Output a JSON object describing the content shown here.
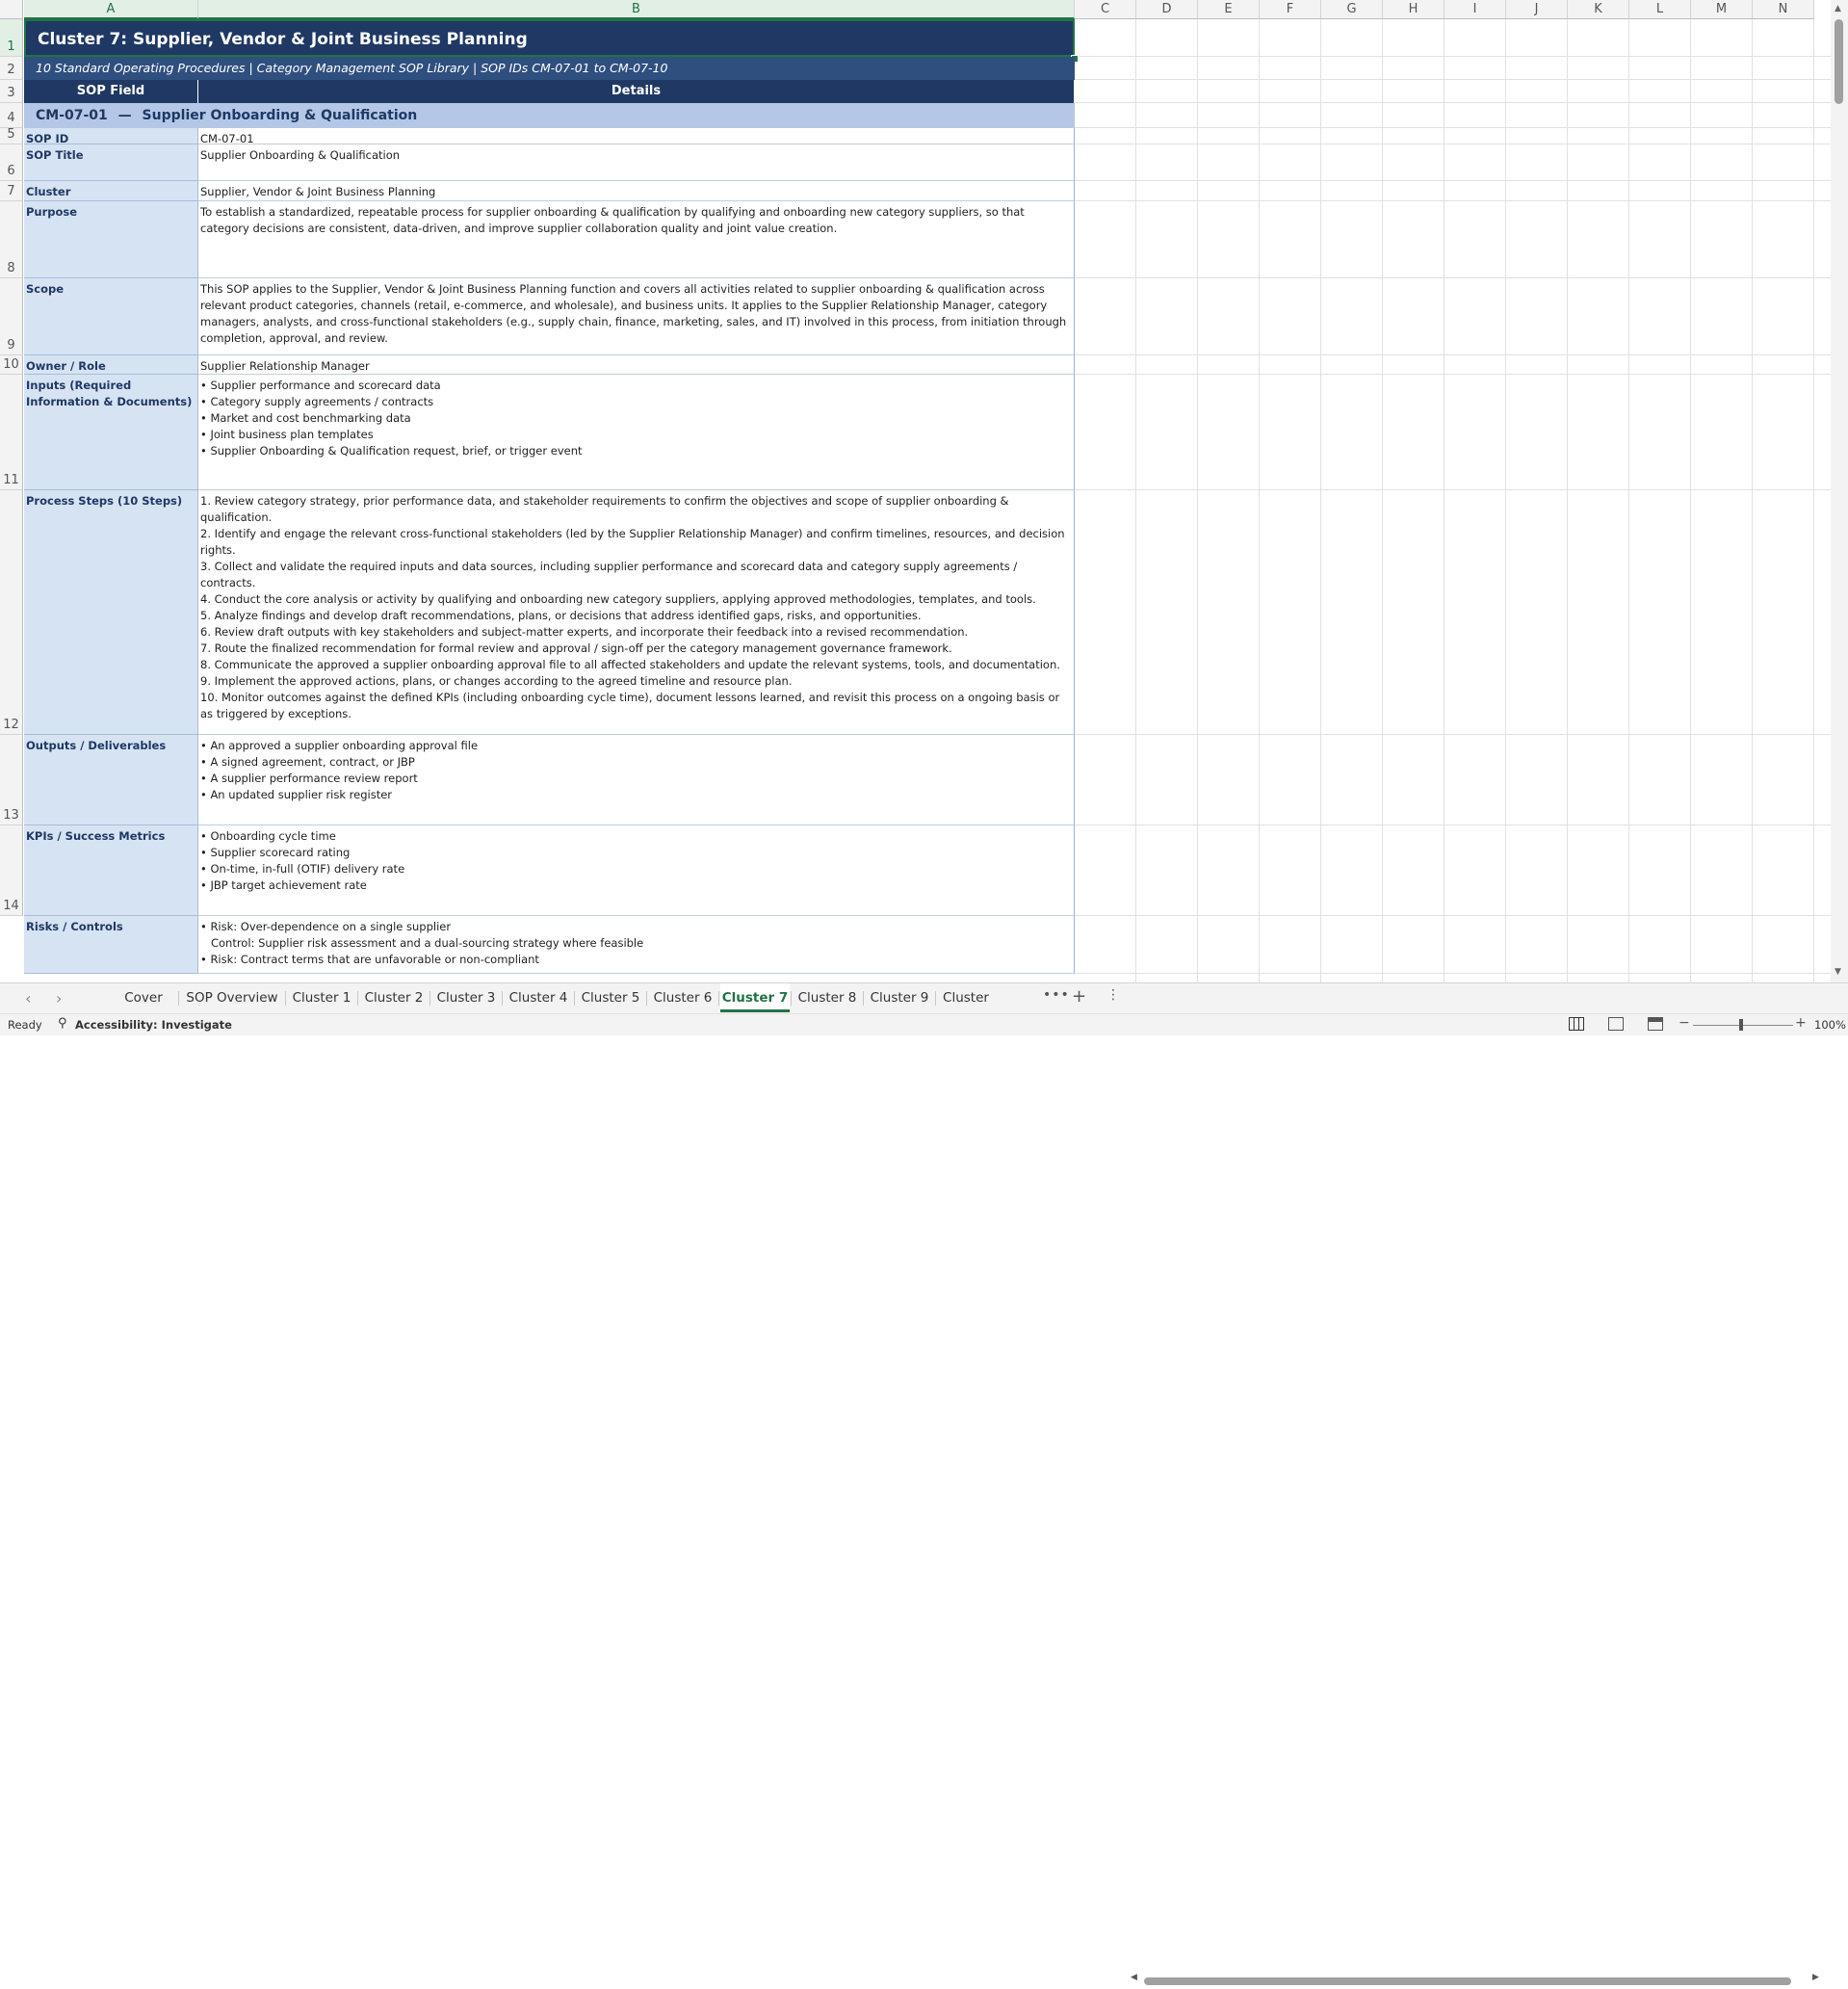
{
  "columns": [
    "A",
    "B",
    "C",
    "D",
    "E",
    "F",
    "G",
    "H",
    "I",
    "J",
    "K",
    "L",
    "M",
    "N"
  ],
  "rows": [
    "1",
    "2",
    "3",
    "4",
    "5",
    "6",
    "7",
    "8",
    "9",
    "10",
    "11",
    "12",
    "13",
    "14"
  ],
  "title": "Cluster 7: Supplier, Vendor & Joint Business Planning",
  "subtitle": "10 Standard Operating Procedures | Category Management SOP Library | SOP IDs CM-07-01 to CM-07-10",
  "header": {
    "field": "SOP Field",
    "details": "Details"
  },
  "section": {
    "id": "CM-07-01",
    "dash": "—",
    "name": "Supplier Onboarding & Qualification"
  },
  "fields": [
    {
      "label": "SOP ID",
      "value": "CM-07-01"
    },
    {
      "label": "SOP Title",
      "value": "Supplier Onboarding & Qualification"
    },
    {
      "label": "Cluster",
      "value": "Supplier, Vendor & Joint Business Planning"
    },
    {
      "label": "Purpose",
      "value": "To establish a standardized, repeatable process for supplier onboarding & qualification by qualifying and onboarding new category suppliers, so that category decisions are consistent, data-driven, and improve supplier collaboration quality and joint value creation."
    },
    {
      "label": "Scope",
      "value": "This SOP applies to the Supplier, Vendor & Joint Business Planning function and covers all activities related to supplier onboarding & qualification across relevant product categories, channels (retail, e-commerce, and wholesale), and business units. It applies to the Supplier Relationship Manager, category managers, analysts, and cross-functional stakeholders (e.g., supply chain, finance, marketing, sales, and IT) involved in this process, from initiation through completion, approval, and review."
    },
    {
      "label": "Owner / Role",
      "value": "Supplier Relationship Manager"
    },
    {
      "label": "Inputs (Required Information & Documents)",
      "value": "• Supplier performance and scorecard data\n• Category supply agreements / contracts\n• Market and cost benchmarking data\n• Joint business plan templates\n• Supplier Onboarding & Qualification request, brief, or trigger event"
    },
    {
      "label": "Process Steps (10 Steps)",
      "value": "1. Review category strategy, prior performance data, and stakeholder requirements to confirm the objectives and scope of supplier onboarding & qualification.\n2. Identify and engage the relevant cross-functional stakeholders (led by the Supplier Relationship Manager) and confirm timelines, resources, and decision rights.\n3. Collect and validate the required inputs and data sources, including supplier performance and scorecard data and category supply agreements / contracts.\n4. Conduct the core analysis or activity by qualifying and onboarding new category suppliers, applying approved methodologies, templates, and tools.\n5. Analyze findings and develop draft recommendations, plans, or decisions that address identified gaps, risks, and opportunities.\n6. Review draft outputs with key stakeholders and subject-matter experts, and incorporate their feedback into a revised recommendation.\n7. Route the finalized recommendation for formal review and approval / sign-off per the category management governance framework.\n8. Communicate the approved a supplier onboarding approval file to all affected stakeholders and update the relevant systems, tools, and documentation.\n9. Implement the approved actions, plans, or changes according to the agreed timeline and resource plan.\n10. Monitor outcomes against the defined KPIs (including onboarding cycle time), document lessons learned, and revisit this process on a ongoing basis or as triggered by exceptions."
    },
    {
      "label": "Outputs / Deliverables",
      "value": "• An approved a supplier onboarding approval file\n• A signed agreement, contract, or JBP\n• A supplier performance review report\n• An updated supplier risk register"
    },
    {
      "label": "KPIs / Success Metrics",
      "value": "• Onboarding cycle time\n• Supplier scorecard rating\n• On-time, in-full (OTIF) delivery rate\n• JBP target achievement rate"
    },
    {
      "label": "Risks / Controls",
      "value": "• Risk: Over-dependence on a single supplier\n   Control: Supplier risk assessment and a dual-sourcing strategy where feasible\n• Risk: Contract terms that are unfavorable or non-compliant"
    }
  ],
  "tabs": [
    "Cover",
    "SOP Overview",
    "Cluster 1",
    "Cluster 2",
    "Cluster 3",
    "Cluster 4",
    "Cluster 5",
    "Cluster 6",
    "Cluster 7",
    "Cluster 8",
    "Cluster 9",
    "Cluster"
  ],
  "active_tab": "Cluster 7",
  "status": {
    "ready": "Ready",
    "accessibility": "Accessibility: Investigate",
    "zoom": "100%"
  },
  "icons": [
    "prev-sheet-icon",
    "next-sheet-icon",
    "more-sheets-icon",
    "add-sheet-icon",
    "options-icon",
    "normal-view-icon",
    "page-layout-icon",
    "page-break-icon",
    "zoom-out-icon",
    "zoom-in-icon",
    "accessibility-icon"
  ],
  "colors": {
    "excel_green": "#217346",
    "title_navy": "#1f3864",
    "field_fill": "#d6e3f3",
    "section_fill": "#b4c7e7"
  }
}
